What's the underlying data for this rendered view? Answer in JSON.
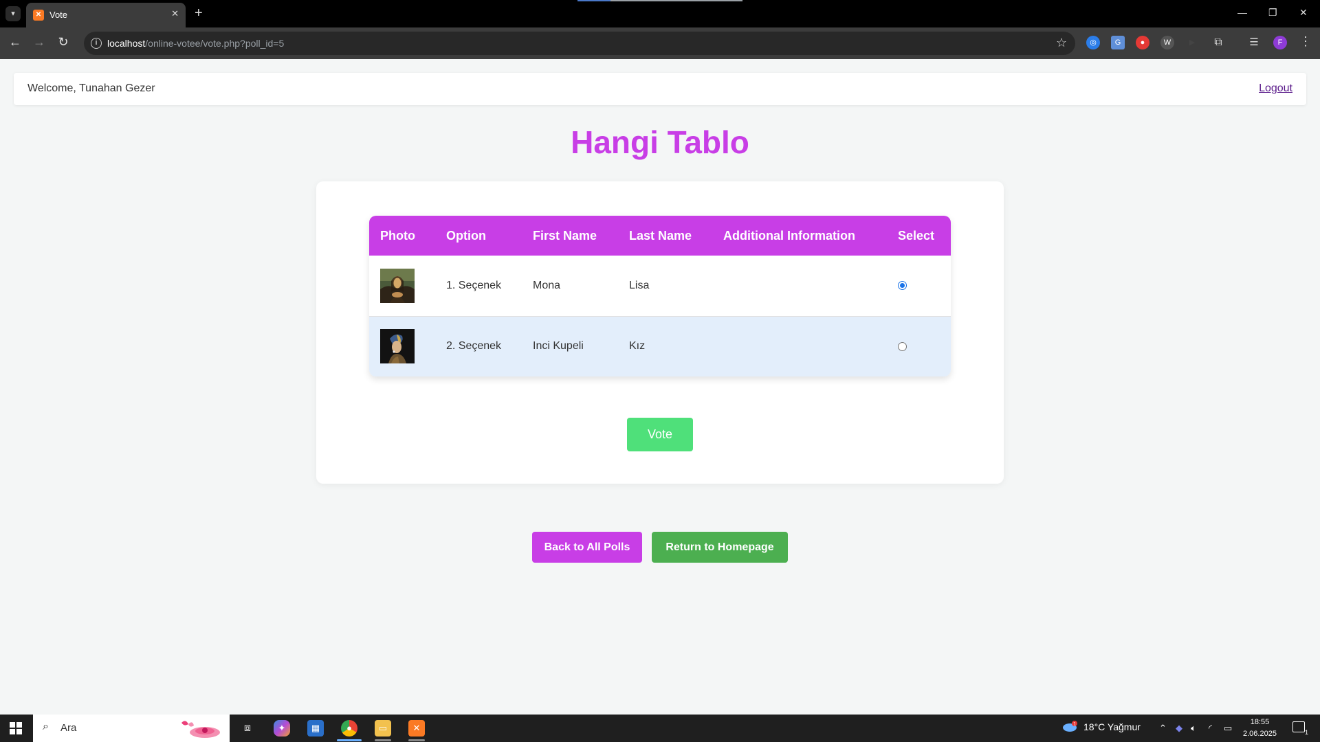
{
  "browser": {
    "tab_title": "Vote",
    "url_host": "localhost",
    "url_path": "/online-votee/vote.php?poll_id=5",
    "profile_initial": "F"
  },
  "header": {
    "welcome": "Welcome, Tunahan Gezer",
    "logout": "Logout"
  },
  "poll": {
    "title": "Hangi Tablo",
    "columns": [
      "Photo",
      "Option",
      "First Name",
      "Last Name",
      "Additional Information",
      "Select"
    ],
    "options": [
      {
        "option": "1. Seçenek",
        "first_name": "Mona",
        "last_name": "Lisa",
        "additional": "",
        "selected": true
      },
      {
        "option": "2. Seçenek",
        "first_name": "Inci Kupeli",
        "last_name": "Kız",
        "additional": "",
        "selected": false
      }
    ],
    "vote_label": "Vote"
  },
  "actions": {
    "back": "Back to All Polls",
    "home": "Return to Homepage"
  },
  "colors": {
    "accent": "#c83ee6",
    "vote_button": "#4fe07a",
    "home_button": "#4caf50"
  },
  "taskbar": {
    "search_placeholder": "Ara",
    "weather": "18°C  Yağmur",
    "time": "18:55",
    "date": "2.06.2025",
    "weather_badge": "1",
    "notification_count": "1"
  }
}
